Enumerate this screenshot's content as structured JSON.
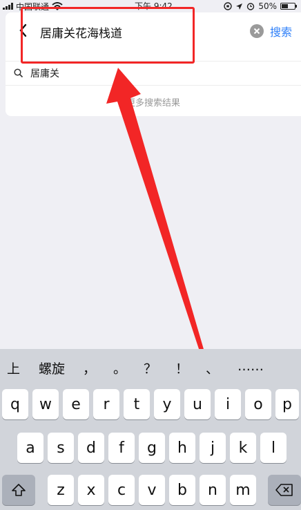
{
  "status_bar": {
    "carrier": "中国联通",
    "time": "下午 9:42",
    "battery": "50%"
  },
  "search": {
    "query": "居庸关花海栈道",
    "button_label": "搜索"
  },
  "suggestions": [
    {
      "text": "居庸关"
    }
  ],
  "more_results": "更多搜索结果",
  "keyboard": {
    "candidates": [
      "上",
      "螺旋",
      "，",
      "。",
      "？",
      "！",
      "、",
      "……"
    ],
    "row1": [
      "q",
      "w",
      "e",
      "r",
      "t",
      "y",
      "u",
      "i",
      "o",
      "p"
    ],
    "row2": [
      "a",
      "s",
      "d",
      "f",
      "g",
      "h",
      "j",
      "k",
      "l"
    ],
    "row3": [
      "z",
      "x",
      "c",
      "v",
      "b",
      "n",
      "m"
    ]
  },
  "colors": {
    "accent": "#2d7ff9",
    "highlight": "#f22626"
  }
}
